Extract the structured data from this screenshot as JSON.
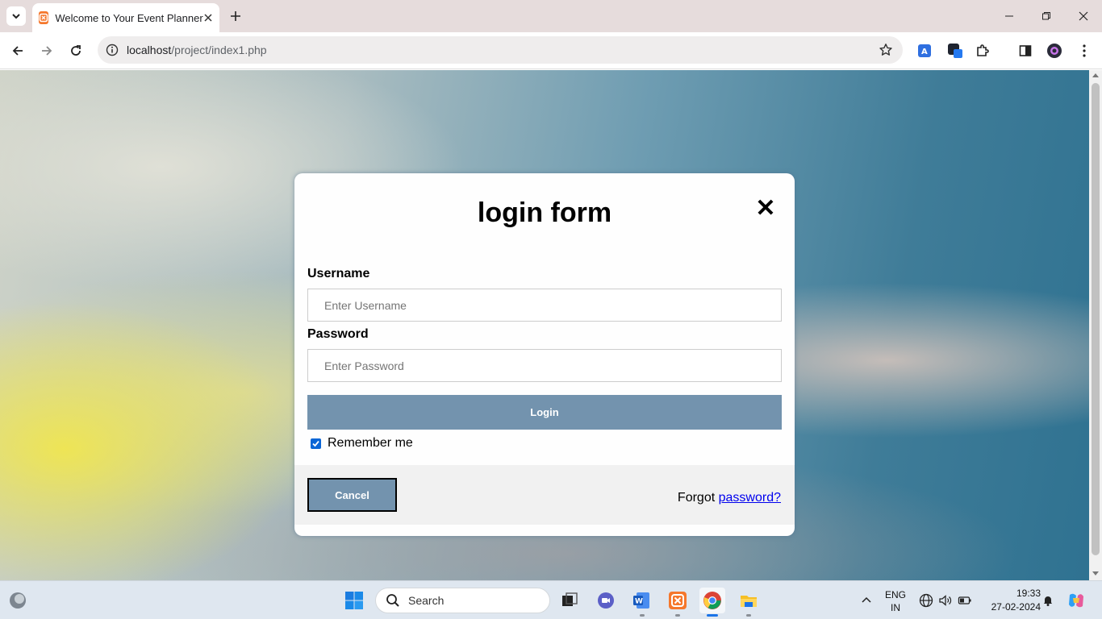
{
  "browser": {
    "tab_title": "Welcome to Your Event Planner",
    "url_host": "localhost",
    "url_path": "/project/index1.php"
  },
  "modal": {
    "title": "login form",
    "close_glyph": "✕",
    "username_label": "Username",
    "username_placeholder": "Enter Username",
    "password_label": "Password",
    "password_placeholder": "Enter Password",
    "login_label": "Login",
    "remember_label": "Remember me",
    "remember_checked": true,
    "cancel_label": "Cancel",
    "forgot_prefix": "Forgot",
    "forgot_link": "password?"
  },
  "taskbar": {
    "search_label": "Search",
    "lang_top": "ENG",
    "lang_bottom": "IN",
    "time": "19:33",
    "date": "27-02-2024"
  },
  "colors": {
    "button_bg": "#7393ae",
    "checkbox": "#0b66d6",
    "link": "#0000ee"
  }
}
